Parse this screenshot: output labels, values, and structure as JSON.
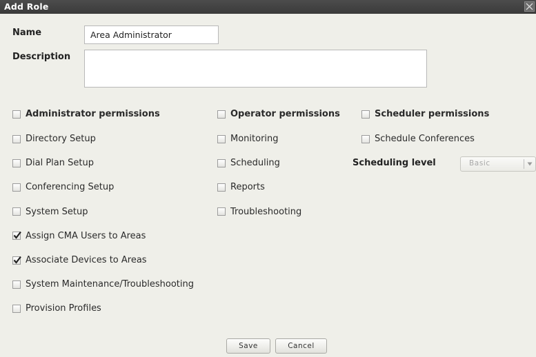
{
  "dialog": {
    "title": "Add Role",
    "close_icon": "close-x-icon"
  },
  "form": {
    "name_label": "Name",
    "name_value": "Area Administrator",
    "description_label": "Description",
    "description_value": ""
  },
  "admin": {
    "header": "Administrator permissions",
    "header_checked": false,
    "items": [
      {
        "label": "Directory Setup",
        "checked": false
      },
      {
        "label": "Dial Plan Setup",
        "checked": false
      },
      {
        "label": "Conferencing Setup",
        "checked": false
      },
      {
        "label": "System Setup",
        "checked": false
      },
      {
        "label": "Assign CMA Users to Areas",
        "checked": true
      },
      {
        "label": "Associate Devices to Areas",
        "checked": true
      },
      {
        "label": "System Maintenance/Troubleshooting",
        "checked": false
      },
      {
        "label": "Provision Profiles",
        "checked": false
      }
    ]
  },
  "operator": {
    "header": "Operator permissions",
    "header_checked": false,
    "items": [
      {
        "label": "Monitoring",
        "checked": false
      },
      {
        "label": "Scheduling",
        "checked": false
      },
      {
        "label": "Reports",
        "checked": false
      },
      {
        "label": "Troubleshooting",
        "checked": false
      }
    ]
  },
  "scheduler": {
    "header": "Scheduler permissions",
    "header_checked": false,
    "items": [
      {
        "label": "Schedule Conferences",
        "checked": false
      }
    ],
    "level_label": "Scheduling level",
    "level_value": "Basic"
  },
  "buttons": {
    "save": "Save",
    "cancel": "Cancel"
  }
}
